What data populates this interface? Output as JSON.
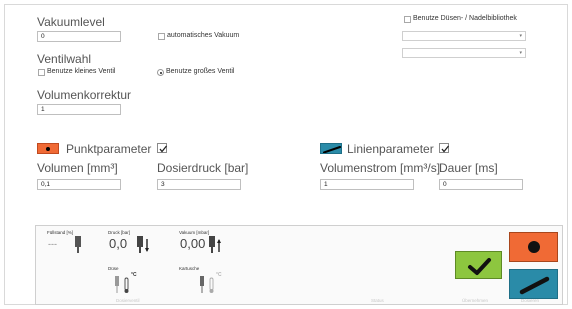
{
  "vakuum": {
    "label": "Vakuumlevel",
    "value": "0",
    "auto_label": "automatisches Vakuum",
    "auto_checked": false
  },
  "library": {
    "label": "Benutze Düsen- / Nadelbibliothek",
    "checked": false,
    "dropdown1": "",
    "dropdown2": ""
  },
  "ventil": {
    "label": "Ventilwahl",
    "small_label": "Benutze kleines Ventil",
    "small_checked": false,
    "large_label": "Benutze großes Ventil",
    "large_selected": true
  },
  "volumenkorrektur": {
    "label": "Volumenkorrektur",
    "value": "1"
  },
  "punkt": {
    "label": "Punktparameter",
    "checked": true,
    "accent": "#f06a35",
    "volumen_label": "Volumen [mm³]",
    "volumen_value": "0,1",
    "druck_label": "Dosierdruck [bar]",
    "druck_value": "3"
  },
  "linie": {
    "label": "Linienparameter",
    "checked": true,
    "accent": "#2a8ba8",
    "strom_label": "Volumenstrom [mm³/s]",
    "strom_value": "1",
    "dauer_label": "Dauer [ms]",
    "dauer_value": "0"
  },
  "status": {
    "fuellstand_label": "Füllstand [%]",
    "fuellstand_value": "---",
    "druck_label": "Druck [bar]",
    "druck_value": "0,0",
    "vakuum_label": "Vakuum [mbar]",
    "vakuum_value": "0,00",
    "duese_label": "Düse",
    "kartusche_label": "Kartusche",
    "temp_unit": "°C",
    "footer": [
      "Dosierventil",
      "Status",
      "Übernehmen",
      "Dosieren"
    ]
  },
  "colors": {
    "confirm": "#8dc63f",
    "dot_button": "#f06a35",
    "line_button": "#2a8ba8"
  }
}
